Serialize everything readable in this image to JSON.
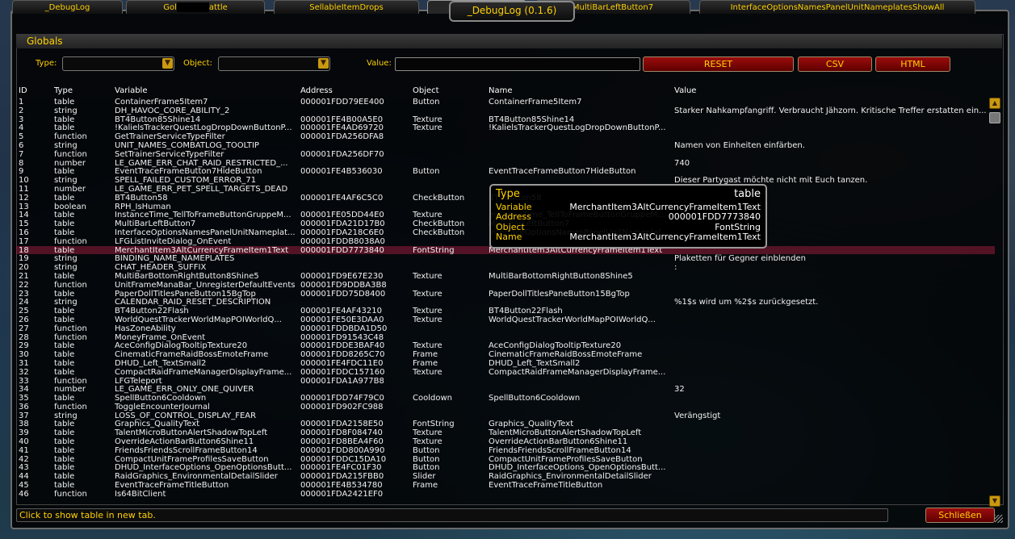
{
  "window": {
    "title": "_DebugLog (0.1.6)"
  },
  "tabs": [
    {
      "label": "_DebugLog",
      "active": false
    },
    {
      "label": "Gol",
      "suffix": "attle",
      "active": false
    },
    {
      "label": "SellableItemDrops",
      "active": false
    },
    {
      "label": "Globals",
      "active": true
    },
    {
      "label": "MultiBarLeftButton7",
      "active": false
    },
    {
      "label": "InterfaceOptionsNamesPanelUnitNameplatesShowAll",
      "active": false
    }
  ],
  "section_title": "Globals",
  "filters": {
    "type_label": "Type:",
    "object_label": "Object:",
    "value_label": "Value:",
    "value_input": "",
    "reset_label": "RESET",
    "csv_label": "CSV",
    "html_label": "HTML"
  },
  "columns": [
    "ID",
    "Type",
    "Variable",
    "Address",
    "Object",
    "Name",
    "Value"
  ],
  "rows": [
    [
      "1",
      "table",
      "ContainerFrame5Item7",
      "000001FDD79EE400",
      "Button",
      "ContainerFrame5Item7",
      ""
    ],
    [
      "2",
      "string",
      "DH_HAVOC_CORE_ABILITY_2",
      "",
      "",
      "",
      "Starker Nahkampfangriff. Verbraucht Jähzorn. Kritische Treffer erstatten ein..."
    ],
    [
      "3",
      "table",
      "BT4Button85Shine14",
      "000001FE4B00A5E0",
      "Texture",
      "BT4Button85Shine14",
      ""
    ],
    [
      "4",
      "table",
      "!KalielsTrackerQuestLogDropDownButtonP...",
      "000001FE4AD69720",
      "Texture",
      "!KalielsTrackerQuestLogDropDownButtonP...",
      ""
    ],
    [
      "5",
      "function",
      "GetTrainerServiceTypeFilter",
      "000001FDA256DFA8",
      "",
      "",
      ""
    ],
    [
      "6",
      "string",
      "UNIT_NAMES_COMBATLOG_TOOLTIP",
      "",
      "",
      "",
      "Namen von Einheiten einfärben."
    ],
    [
      "7",
      "function",
      "SetTrainerServiceTypeFilter",
      "000001FDA256DF70",
      "",
      "",
      ""
    ],
    [
      "8",
      "number",
      "LE_GAME_ERR_CHAT_RAID_RESTRICTED_...",
      "",
      "",
      "",
      "740"
    ],
    [
      "9",
      "table",
      "EventTraceFrameButton7HideButton",
      "000001FE4B536030",
      "Button",
      "EventTraceFrameButton7HideButton",
      ""
    ],
    [
      "10",
      "string",
      "SPELL_FAILED_CUSTOM_ERROR_71",
      "",
      "",
      "",
      "Dieser Partygast möchte nicht mit Euch tanzen."
    ],
    [
      "11",
      "number",
      "LE_GAME_ERR_PET_SPELL_TARGETS_DEAD",
      "",
      "",
      "",
      ""
    ],
    [
      "12",
      "table",
      "BT4Button58",
      "000001FE4AF6C5C0",
      "CheckButton",
      "BT4Button58",
      ""
    ],
    [
      "13",
      "boolean",
      "RPH_IsHuman",
      "",
      "",
      "",
      ""
    ],
    [
      "14",
      "table",
      "InstanceTime_TellToFrameButtonGruppeM...",
      "000001FE05DD44E0",
      "Texture",
      "InstanceTime_TellToFrameButtonGruppeM...",
      ""
    ],
    [
      "15",
      "table",
      "MultiBarLeftButton7",
      "000001FDA21D17B0",
      "CheckButton",
      "MultiBarLeftButton7",
      ""
    ],
    [
      "16",
      "table",
      "InterfaceOptionsNamesPanelUnitNameplat...",
      "000001FDA218C6E0",
      "CheckButton",
      "InterfaceOptionsNamesPanelUnitNameplat...",
      ""
    ],
    [
      "17",
      "function",
      "LFGListInviteDialog_OnEvent",
      "000001FDDB8038A0",
      "",
      "",
      ""
    ],
    [
      "18",
      "table",
      "MerchantItem3AltCurrencyFrameItem1Text",
      "000001FDD7773840",
      "FontString",
      "MerchantItem3AltCurrencyFrameItem1Text",
      ""
    ],
    [
      "19",
      "string",
      "BINDING_NAME_NAMEPLATES",
      "",
      "",
      "",
      "Plaketten für Gegner einblenden"
    ],
    [
      "20",
      "string",
      "CHAT_HEADER_SUFFIX",
      "",
      "",
      "",
      ":"
    ],
    [
      "21",
      "table",
      "MultiBarBottomRightButton8Shine5",
      "000001FD9E67E230",
      "Texture",
      "MultiBarBottomRightButton8Shine5",
      ""
    ],
    [
      "22",
      "function",
      "UnitFrameManaBar_UnregisterDefaultEvents",
      "000001FD9DDBA3B8",
      "",
      "",
      ""
    ],
    [
      "23",
      "table",
      "PaperDollTitlesPaneButton15BgTop",
      "000001FDD75D8400",
      "Texture",
      "PaperDollTitlesPaneButton15BgTop",
      ""
    ],
    [
      "24",
      "string",
      "CALENDAR_RAID_RESET_DESCRIPTION",
      "",
      "",
      "",
      "%1$s wird um %2$s zurückgesetzt."
    ],
    [
      "25",
      "table",
      "BT4Button22Flash",
      "000001FE4AF43210",
      "Texture",
      "BT4Button22Flash",
      ""
    ],
    [
      "26",
      "table",
      "WorldQuestTrackerWorldMapPOIWorldQ...",
      "000001FE50E3DAA0",
      "Texture",
      "WorldQuestTrackerWorldMapPOIWorldQ...",
      ""
    ],
    [
      "27",
      "function",
      "HasZoneAbility",
      "000001FDDBDA1D50",
      "",
      "",
      ""
    ],
    [
      "28",
      "function",
      "MoneyFrame_OnEvent",
      "000001FD91543C48",
      "",
      "",
      ""
    ],
    [
      "29",
      "table",
      "AceConfigDialogTooltipTexture20",
      "000001FDDE3BAF40",
      "Texture",
      "AceConfigDialogTooltipTexture20",
      ""
    ],
    [
      "30",
      "table",
      "CinematicFrameRaidBossEmoteFrame",
      "000001FDD8265C70",
      "Frame",
      "CinematicFrameRaidBossEmoteFrame",
      ""
    ],
    [
      "31",
      "table",
      "DHUD_Left_TextSmall2",
      "000001FE4FDC11E0",
      "Frame",
      "DHUD_Left_TextSmall2",
      ""
    ],
    [
      "32",
      "table",
      "CompactRaidFrameManagerDisplayFrame...",
      "000001FDDC157160",
      "Texture",
      "CompactRaidFrameManagerDisplayFrame...",
      ""
    ],
    [
      "33",
      "function",
      "LFGTeleport",
      "000001FDA1A977B8",
      "",
      "",
      ""
    ],
    [
      "34",
      "number",
      "LE_GAME_ERR_ONLY_ONE_QUIVER",
      "",
      "",
      "",
      "32"
    ],
    [
      "35",
      "table",
      "SpellButton6Cooldown",
      "000001FDD74F79C0",
      "Cooldown",
      "SpellButton6Cooldown",
      ""
    ],
    [
      "36",
      "function",
      "ToggleEncounterJournal",
      "000001FD902FC988",
      "",
      "",
      ""
    ],
    [
      "37",
      "string",
      "LOSS_OF_CONTROL_DISPLAY_FEAR",
      "",
      "",
      "",
      "Verängstigt"
    ],
    [
      "38",
      "table",
      "Graphics_QualityText",
      "000001FDA2158E50",
      "FontString",
      "Graphics_QualityText",
      ""
    ],
    [
      "39",
      "table",
      "TalentMicroButtonAlertShadowTopLeft",
      "000001FD8F084740",
      "Texture",
      "TalentMicroButtonAlertShadowTopLeft",
      ""
    ],
    [
      "40",
      "table",
      "OverrideActionBarButton6Shine11",
      "000001FD8BEA4F60",
      "Texture",
      "OverrideActionBarButton6Shine11",
      ""
    ],
    [
      "41",
      "table",
      "FriendsFriendsScrollFrameButton14",
      "000001FDD800A990",
      "Button",
      "FriendsFriendsScrollFrameButton14",
      ""
    ],
    [
      "42",
      "table",
      "CompactUnitFrameProfilesSaveButton",
      "000001FDDC15DA10",
      "Button",
      "CompactUnitFrameProfilesSaveButton",
      ""
    ],
    [
      "43",
      "table",
      "DHUD_InterfaceOptions_OpenOptionsButt...",
      "000001FE4FC01F30",
      "Button",
      "DHUD_InterfaceOptions_OpenOptionsButt...",
      ""
    ],
    [
      "44",
      "table",
      "RaidGraphics_EnvironmentalDetailSlider",
      "000001FDA215FBB0",
      "Slider",
      "RaidGraphics_EnvironmentalDetailSlider",
      ""
    ],
    [
      "45",
      "table",
      "EventTraceFrameTitleButton",
      "000001FE4B534780",
      "Frame",
      "EventTraceFrameTitleButton",
      ""
    ],
    [
      "46",
      "function",
      "Is64BitClient",
      "000001FDA2421EF0",
      "",
      "",
      ""
    ]
  ],
  "selected_row": 17,
  "tooltip": {
    "type_key": "Type",
    "type_val": "table",
    "var_key": "Variable",
    "var_val": "MerchantItem3AltCurrencyFrameItem1Text",
    "addr_key": "Address",
    "addr_val": "000001FDD7773840",
    "obj_key": "Object",
    "obj_val": "FontString",
    "name_key": "Name",
    "name_val": "MerchantItem3AltCurrencyFrameItem1Text"
  },
  "status_text": "Click to show table in new tab.",
  "close_label": "Schließen"
}
